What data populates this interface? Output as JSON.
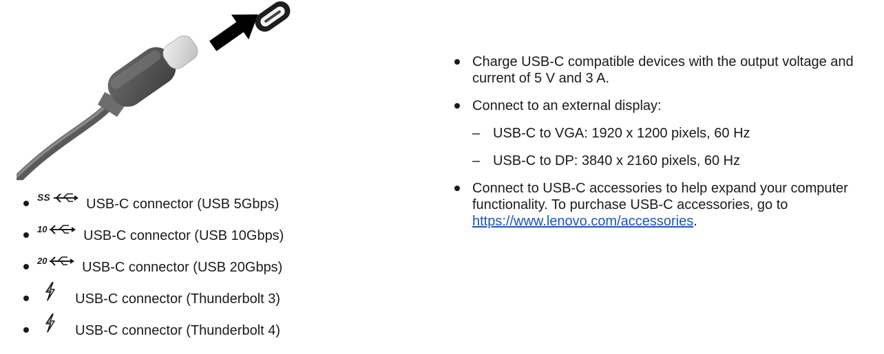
{
  "connectors": [
    {
      "icon": "ss-usb-icon",
      "icon_text": "SS",
      "label": "USB-C connector (USB 5Gbps)"
    },
    {
      "icon": "usb-10-icon",
      "icon_text": "10",
      "label": "USB-C connector (USB 10Gbps)"
    },
    {
      "icon": "usb-20-icon",
      "icon_text": "20",
      "label": "USB-C connector (USB 20Gbps)"
    },
    {
      "icon": "thunderbolt-icon",
      "label": "USB-C connector (Thunderbolt 3)"
    },
    {
      "icon": "thunderbolt-icon",
      "label": "USB-C connector (Thunderbolt 4)"
    }
  ],
  "features": {
    "charge": "Charge USB-C compatible devices with the output voltage and current of 5 V and 3 A.",
    "display_intro": "Connect to an external display:",
    "display_vga": "USB-C to VGA: 1920 x 1200 pixels, 60 Hz",
    "display_dp": "USB-C to DP: 3840 x 2160 pixels, 60 Hz",
    "dash": "–",
    "accessories_prefix": "Connect to USB-C accessories to help expand your computer functionality. To purchase USB-C accessories, go to ",
    "accessories_link": "https://www.lenovo.com/accessories",
    "accessories_suffix": "."
  },
  "colors": {
    "text": "#1a1a1a",
    "link": "#1a55b8",
    "cable_dark": "#555555",
    "cable_light": "#9a9a9a",
    "arrow": "#000000"
  }
}
